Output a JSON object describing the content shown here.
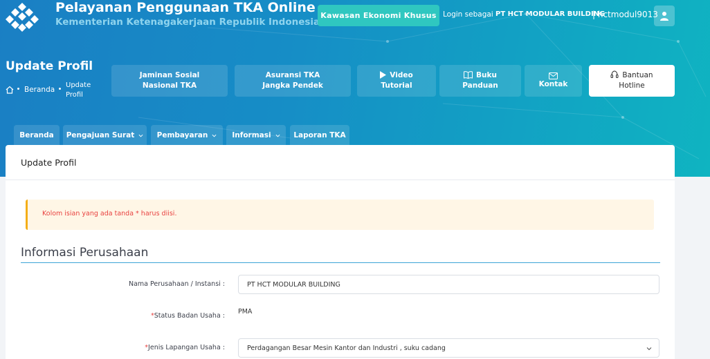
{
  "header": {
    "app_title": "Pelayanan Penggunaan TKA Online",
    "app_subtitle": "Kementerian Ketenagakerjaan Republik Indonesia",
    "kek_button": "Kawasan Ekonomi Khusus",
    "login_as_label": "Login sebagai",
    "company_name": "PT HCT MODULAR BUILDING",
    "user_id": "| hctmodul9013"
  },
  "page": {
    "title": "Update Profil",
    "breadcrumb": [
      "Beranda",
      "Update Profil"
    ]
  },
  "quick_links": [
    {
      "label": "Jaminan Sosial Nasional TKA",
      "icon": ""
    },
    {
      "label": "Asuransi TKA Jangka Pendek",
      "icon": ""
    },
    {
      "label": "Video Tutorial",
      "icon": "play-icon"
    },
    {
      "label": "Buku Panduan",
      "icon": "book-icon"
    },
    {
      "label": "Kontak",
      "icon": "mail-icon"
    },
    {
      "label": "Bantuan Hotline",
      "icon": "headset-icon"
    }
  ],
  "nav": [
    {
      "label": "Beranda",
      "dropdown": false
    },
    {
      "label": "Pengajuan Surat",
      "dropdown": true
    },
    {
      "label": "Pembayaran",
      "dropdown": true
    },
    {
      "label": "Informasi",
      "dropdown": true
    },
    {
      "label": "Laporan TKA",
      "dropdown": false
    }
  ],
  "card": {
    "title": "Update Profil",
    "alert": "Kolom isian yang ada tanda * harus diisi.",
    "section_title": "Informasi Perusahaan",
    "fields": [
      {
        "label": "Nama Perusahaan / Instansi :",
        "required": false,
        "type": "input",
        "value": "PT HCT MODULAR BUILDING"
      },
      {
        "label": "Status Badan Usaha :",
        "required": true,
        "type": "text",
        "value": "PMA"
      },
      {
        "label": "Jenis Lapangan Usaha :",
        "required": true,
        "type": "select",
        "value": "Perdagangan Besar Mesin Kantor dan Industri , suku cadang"
      }
    ]
  },
  "colors": {
    "banner_start": "#1a7fc4",
    "banner_end": "#0fb4c1",
    "kek_button": "#2fc7c0",
    "alert_bg": "#fff6e6",
    "alert_border": "#f4ae17",
    "alert_text": "#e8413f",
    "section_line": "#3aa3d6"
  }
}
